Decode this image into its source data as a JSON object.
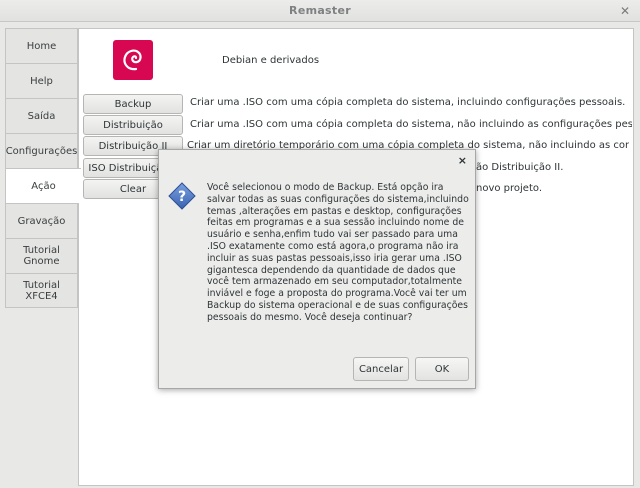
{
  "window": {
    "title": "Remaster"
  },
  "tabs": [
    {
      "label": "Home"
    },
    {
      "label": "Help"
    },
    {
      "label": "Saída"
    },
    {
      "label": "Configurações"
    },
    {
      "label": "Ação"
    },
    {
      "label": "Gravação"
    },
    {
      "label": "Tutorial Gnome"
    },
    {
      "label": "Tutorial XFCE4"
    }
  ],
  "active_tab": "Ação",
  "main": {
    "distro_label": "Debian e derivados",
    "actions": [
      {
        "button": "Backup",
        "desc": "Criar uma .ISO com uma cópia completa do sistema, incluindo configurações pessoais."
      },
      {
        "button": "Distribuição",
        "desc": "Criar uma .ISO com uma cópia completa do sistema, não incluindo as configurações pessoais."
      },
      {
        "button": "Distribuição II",
        "desc": "Criar um diretório temporário com uma cópia completa do sistema, não incluindo as configurações pessoais"
      },
      {
        "button": "ISO Distribuição II",
        "desc": "ão Distribuição II."
      },
      {
        "button": "Clear",
        "desc": "novo projeto."
      }
    ]
  },
  "dialog": {
    "close_glyph": "×",
    "message": "Você selecionou o modo de Backup. Está opção ira salvar todas as suas configurações do sistema,incluindo temas ,alterações em pastas e desktop, configurações feitas em programas e a sua sessão incluindo nome de usuário e senha,enfim tudo vai ser passado para uma .ISO exatamente como está agora,o programa não ira incluir as suas pastas pessoais,isso iria gerar uma .ISO gigantesca dependendo da quantidade de dados que você tem armazenado em seu computador,totalmente inviável e foge a proposta do programa.Você vai ter um Backup do sistema operacional e de suas configurações pessoais do mesmo. Você deseja continuar?",
    "cancel_label": "Cancelar",
    "ok_label": "OK"
  },
  "colors": {
    "debian_red": "#d70751",
    "question_blue": "#4a74c0"
  }
}
